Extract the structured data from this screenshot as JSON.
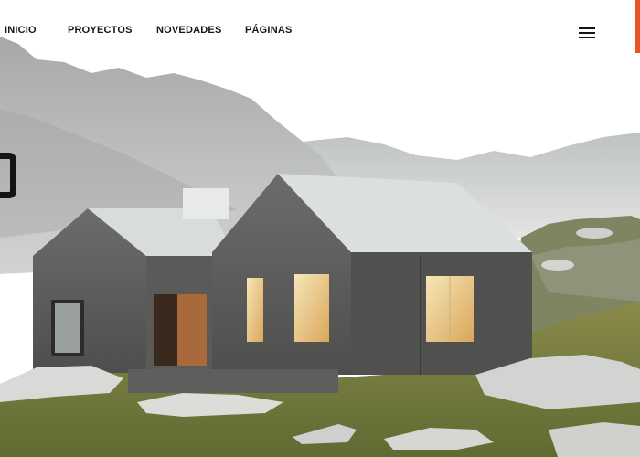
{
  "nav": {
    "items": [
      {
        "label": "INICIO"
      },
      {
        "label": "PROYECTOS"
      },
      {
        "label": "NOVEDADES"
      },
      {
        "label": "PÁGINAS"
      }
    ],
    "menu_icon": "hamburger-menu-icon"
  },
  "accent_color": "#e8541f",
  "hero": {
    "image": "cabin-in-mountains-photo"
  }
}
